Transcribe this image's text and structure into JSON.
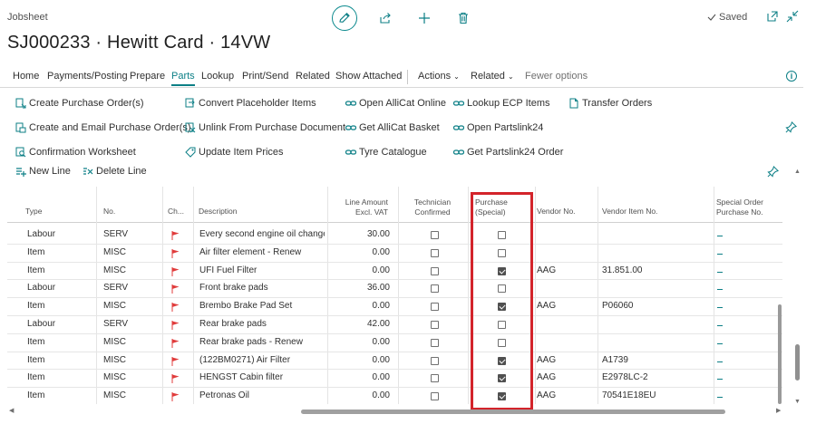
{
  "page": {
    "caption": "Jobsheet",
    "title": "SJ000233 · Hewitt Card · 14VW",
    "saved_label": "Saved"
  },
  "top_icons": [
    "pencil-icon",
    "share-icon",
    "plus-icon",
    "trash-icon"
  ],
  "menu": {
    "items": [
      "Home",
      "Payments/Posting",
      "Prepare",
      "Parts",
      "Lookup",
      "Print/Send",
      "Related",
      "Show Attached"
    ],
    "active": "Parts",
    "actions_label": "Actions",
    "related_label": "Related",
    "fewer_label": "Fewer options"
  },
  "actions": {
    "col1": [
      "Create Purchase Order(s)",
      "Create and Email Purchase Order(s)",
      "Confirmation Worksheet"
    ],
    "col2": [
      "Convert Placeholder Items",
      "Unlink From Purchase Document",
      "Update Item Prices"
    ],
    "col3": [
      "Open AlliCat Online",
      "Get AlliCat Basket",
      "Tyre Catalogue"
    ],
    "col4": [
      "Lookup ECP Items",
      "Open Partslink24",
      "Get Partslink24 Order"
    ],
    "col5": [
      "Transfer Orders"
    ]
  },
  "lines_toolbar": {
    "new_line": "New Line",
    "delete_line": "Delete Line"
  },
  "grid": {
    "headers": {
      "type": "Type",
      "no": "No.",
      "ch": "Ch...",
      "description": "Description",
      "line_amount_1": "Line Amount",
      "line_amount_2": "Excl. VAT",
      "tech_1": "Technician",
      "tech_2": "Confirmed",
      "purchase_1": "Purchase",
      "purchase_2": "(Special)",
      "vendor_no": "Vendor No.",
      "vendor_item_no": "Vendor Item No.",
      "special_1": "Special Order",
      "special_2": "Purchase No."
    },
    "rows": [
      {
        "type": "Labour",
        "no": "SERV",
        "description": "Every second engine oil change",
        "amount": "30.00",
        "tech": false,
        "purchase": false,
        "vendor": "",
        "vendor_item": ""
      },
      {
        "type": "Item",
        "no": "MISC",
        "description": "Air filter element - Renew",
        "amount": "0.00",
        "tech": false,
        "purchase": false,
        "vendor": "",
        "vendor_item": ""
      },
      {
        "type": "Item",
        "no": "MISC",
        "description": "UFI Fuel Filter",
        "amount": "0.00",
        "tech": false,
        "purchase": true,
        "vendor": "AAG",
        "vendor_item": "31.851.00"
      },
      {
        "type": "Labour",
        "no": "SERV",
        "description": "Front brake pads",
        "amount": "36.00",
        "tech": false,
        "purchase": false,
        "vendor": "",
        "vendor_item": ""
      },
      {
        "type": "Item",
        "no": "MISC",
        "description": "Brembo Brake Pad Set",
        "amount": "0.00",
        "tech": false,
        "purchase": true,
        "vendor": "AAG",
        "vendor_item": "P06060"
      },
      {
        "type": "Labour",
        "no": "SERV",
        "description": "Rear brake pads",
        "amount": "42.00",
        "tech": false,
        "purchase": false,
        "vendor": "",
        "vendor_item": ""
      },
      {
        "type": "Item",
        "no": "MISC",
        "description": "Rear brake pads - Renew",
        "amount": "0.00",
        "tech": false,
        "purchase": false,
        "vendor": "",
        "vendor_item": ""
      },
      {
        "type": "Item",
        "no": "MISC",
        "description": "(122BM0271) Air Filter",
        "amount": "0.00",
        "tech": false,
        "purchase": true,
        "vendor": "AAG",
        "vendor_item": "A1739"
      },
      {
        "type": "Item",
        "no": "MISC",
        "description": "HENGST Cabin filter",
        "amount": "0.00",
        "tech": false,
        "purchase": true,
        "vendor": "AAG",
        "vendor_item": "E2978LC-2"
      },
      {
        "type": "Item",
        "no": "MISC",
        "description": "Petronas Oil",
        "amount": "0.00",
        "tech": false,
        "purchase": true,
        "vendor": "AAG",
        "vendor_item": "70541E18EU"
      }
    ]
  },
  "colors": {
    "accent": "#0c7f86",
    "flag": "#e03c3c",
    "highlight": "#d3242b"
  }
}
